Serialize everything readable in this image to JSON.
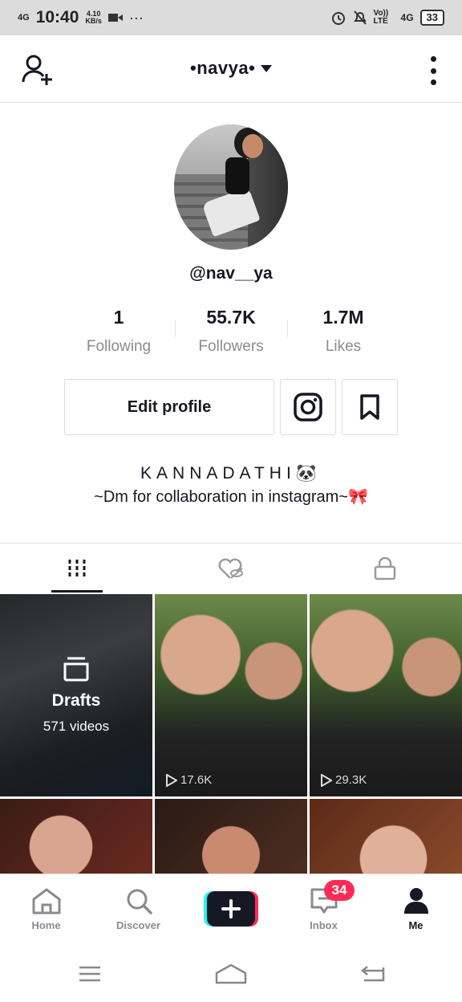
{
  "status_bar": {
    "network": "4G",
    "time": "10:40",
    "speed_value": "4.10",
    "speed_unit": "KB/s",
    "dots": "···",
    "volte": "Vo)) LTE",
    "network_right": "4G",
    "battery": "33"
  },
  "header": {
    "title": "•navya•",
    "add_user_icon": "add-user-icon",
    "dropdown_icon": "caret-down-icon",
    "more_icon": "more-vertical-icon"
  },
  "profile": {
    "username": "@nav__ya"
  },
  "stats": [
    {
      "value": "1",
      "label": "Following"
    },
    {
      "value": "55.7K",
      "label": "Followers"
    },
    {
      "value": "1.7M",
      "label": "Likes"
    }
  ],
  "actions": {
    "edit_profile": "Edit profile",
    "instagram_icon": "instagram-icon",
    "bookmark_icon": "bookmark-icon"
  },
  "bio": {
    "line1": "KANNADATHI🐼",
    "line2": "~Dm for collaboration in instagram~🎀"
  },
  "tabs": [
    {
      "icon": "videos-grid-icon",
      "active": true
    },
    {
      "icon": "liked-hidden-icon",
      "active": false
    },
    {
      "icon": "private-lock-icon",
      "active": false
    }
  ],
  "grid": {
    "drafts_title": "Drafts",
    "drafts_count": "571 videos",
    "views": [
      "17.6K",
      "29.3K"
    ]
  },
  "bottom_nav": [
    {
      "label": "Home",
      "icon": "home-icon"
    },
    {
      "label": "Discover",
      "icon": "search-icon"
    },
    {
      "label": "",
      "icon": "plus-icon"
    },
    {
      "label": "Inbox",
      "icon": "inbox-icon"
    },
    {
      "label": "Me",
      "icon": "profile-icon"
    }
  ],
  "inbox_badge": "34",
  "colors": {
    "accent_red": "#fe2c55",
    "accent_cyan": "#25f4ee",
    "text_primary": "#161823",
    "text_secondary": "#8a8b91"
  }
}
